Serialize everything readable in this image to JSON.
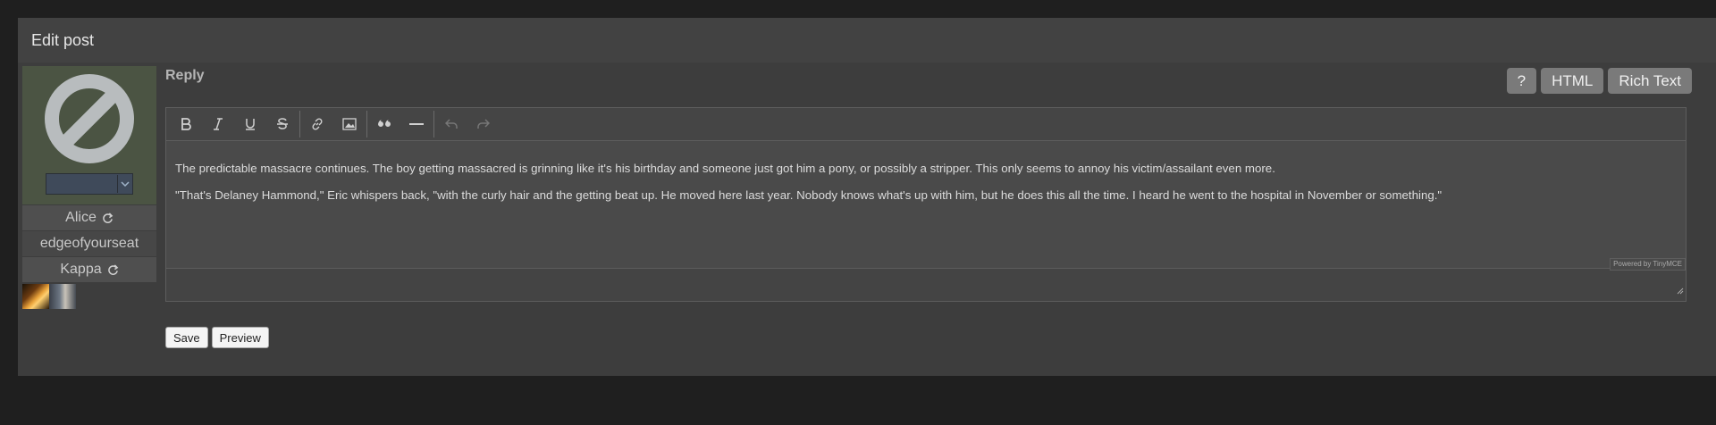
{
  "panel": {
    "title": "Edit post"
  },
  "user": {
    "rows": [
      {
        "label": "Alice",
        "refresh": true
      },
      {
        "label": "edgeofyourseat",
        "refresh": false
      },
      {
        "label": "Kappa",
        "refresh": true
      }
    ]
  },
  "editor": {
    "label": "Reply",
    "modes": [
      "?",
      "HTML",
      "Rich Text"
    ],
    "paragraphs": [
      "The predictable massacre continues. The boy getting massacred is grinning like it's his birthday and someone just got him a pony, or possibly a stripper. This only seems to annoy his victim/assailant even more.",
      "\"That's Delaney Hammond,\" Eric whispers back, \"with the curly hair and the getting beat up. He moved here last year. Nobody knows what's up with him, but he does this all the time. I heard he went to the hospital in November or something.\""
    ],
    "powered_by": "Powered by TinyMCE",
    "toolbar": [
      "bold-icon",
      "italic-icon",
      "underline-icon",
      "strikethrough-icon",
      "link-icon",
      "image-icon",
      "blockquote-icon",
      "hr-icon",
      "undo-icon",
      "redo-icon"
    ]
  },
  "actions": {
    "save": "Save",
    "preview": "Preview"
  }
}
